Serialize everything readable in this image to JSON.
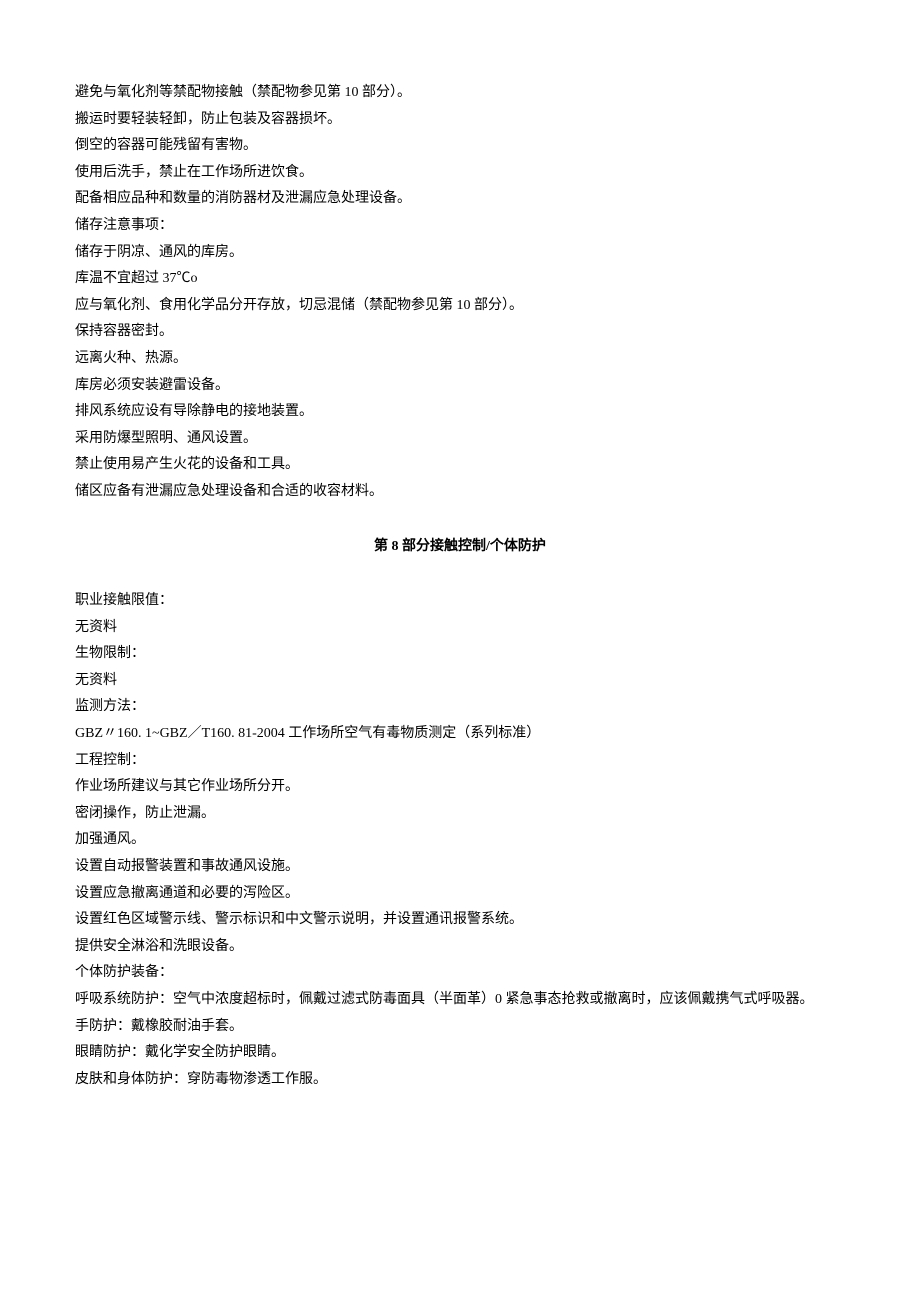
{
  "part1": [
    "避免与氧化剂等禁配物接触（禁配物参见第 10 部分）。",
    "搬运时要轻装轻卸，防止包装及容器损坏。",
    "倒空的容器可能残留有害物。",
    "使用后洗手，禁止在工作场所进饮食。",
    "配备相应品种和数量的消防器材及泄漏应急处理设备。",
    "储存注意事项：",
    "储存于阴凉、通风的库房。",
    "库温不宜超过 37℃o",
    "应与氧化剂、食用化学品分开存放，切忌混储（禁配物参见第 10 部分）。",
    "保持容器密封。",
    "远离火种、热源。",
    "库房必须安装避雷设备。",
    "排风系统应设有导除静电的接地装置。",
    "采用防爆型照明、通风设置。",
    "禁止使用易产生火花的设备和工具。",
    "储区应备有泄漏应急处理设备和合适的收容材料。"
  ],
  "sectionTitle": {
    "prefix": "第  ",
    "num": "8",
    "suffix": " 部分接触控制/个体防护"
  },
  "part2": [
    "职业接触限值：",
    "无资料",
    "生物限制：",
    "无资料",
    "监测方法：",
    "GBZ〃160. 1~GBZ／T160. 81-2004 工作场所空气有毒物质测定（系列标准）",
    "工程控制：",
    "作业场所建议与其它作业场所分开。",
    "密闭操作，防止泄漏。",
    "加强通风。",
    "设置自动报警装置和事故通风设施。",
    "设置应急撤离通道和必要的泻险区。",
    "设置红色区域警示线、警示标识和中文警示说明，并设置通讯报警系统。",
    "提供安全淋浴和洗眼设备。",
    "个体防护装备：",
    "呼吸系统防护：空气中浓度超标时，佩戴过滤式防毒面具（半面革）0 紧急事态抢救或撤离时，应该佩戴携气式呼吸器。",
    "手防护：戴橡胶耐油手套。",
    "眼睛防护：戴化学安全防护眼睛。",
    "皮肤和身体防护：穿防毒物渗透工作服。"
  ]
}
